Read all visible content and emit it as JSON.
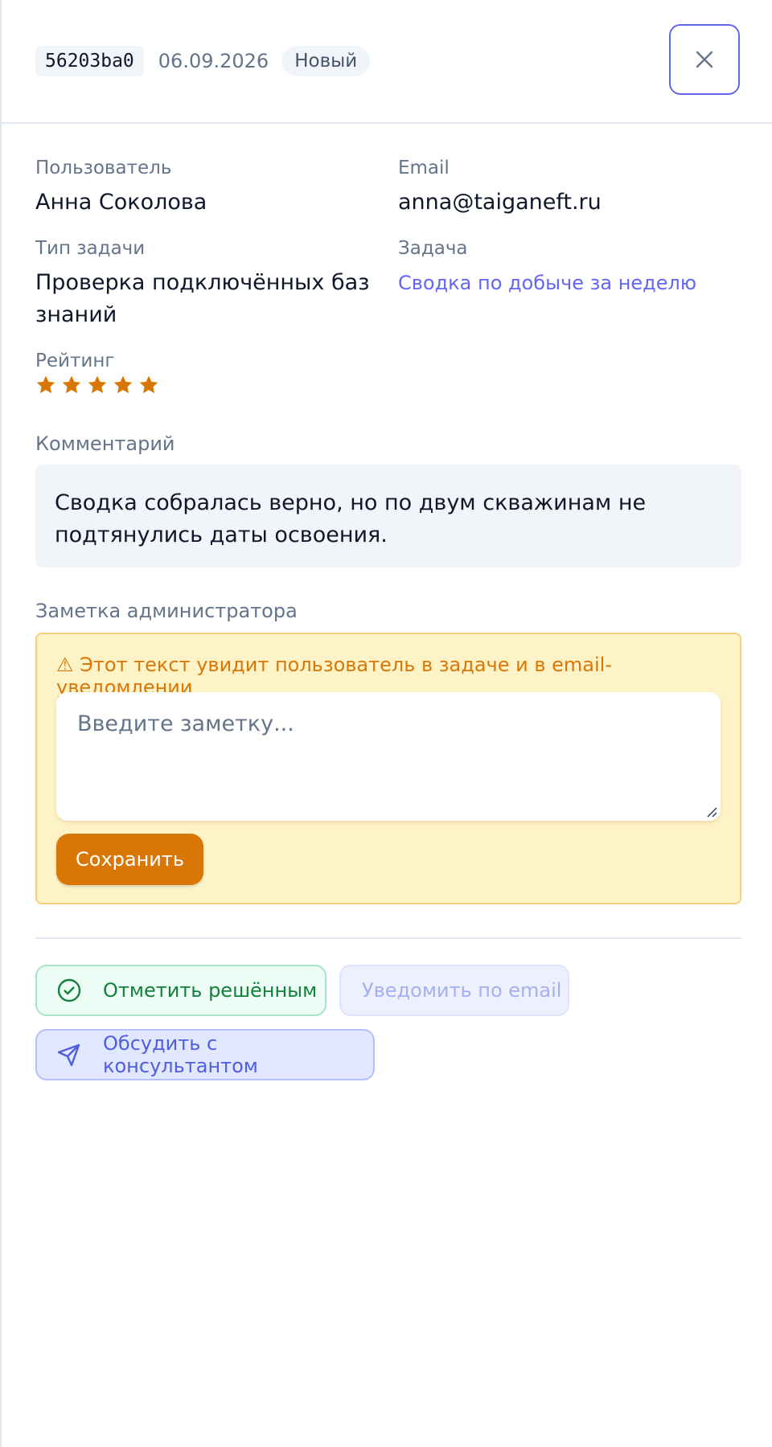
{
  "header": {
    "request_id": "56203ba0",
    "date": "06.09.2026",
    "status": "Новый"
  },
  "fields": {
    "user_label": "Пользователь",
    "user_value": "Анна Соколова",
    "email_label": "Email",
    "email_value": "anna@taiganeft.ru",
    "task_type_label": "Тип задачи",
    "task_type_line1": "Проверка подключённых баз",
    "task_type_line2": "знаний",
    "task_label": "Задача",
    "task_value": "Сводка по добыче за неделю",
    "rating_label": "Рейтинг",
    "rating_value": 5,
    "rating_max": 5
  },
  "comment": {
    "label": "Комментарий",
    "line1": "Сводка собралась верно, но по двум скважинам не",
    "line2": "подтянулись даты освоения."
  },
  "admin_note": {
    "label": "Заметка администратора",
    "warning": "⚠ Этот текст увидит пользователь в задаче и в email-уведомлении",
    "placeholder": "Введите заметку...",
    "value": "",
    "save_label": "Сохранить"
  },
  "actions": {
    "resolve_label": "Отметить решённым",
    "notify_label": "Уведомить по email",
    "consult_label": "Обсудить с консультантом"
  },
  "colors": {
    "accent": "#6366f1",
    "warning": "#d97706",
    "success": "#15803d",
    "star": "#d97706"
  },
  "icons": {
    "close": "close-icon",
    "star": "star-icon",
    "resolve": "check-circle-icon",
    "consult": "send-icon"
  }
}
